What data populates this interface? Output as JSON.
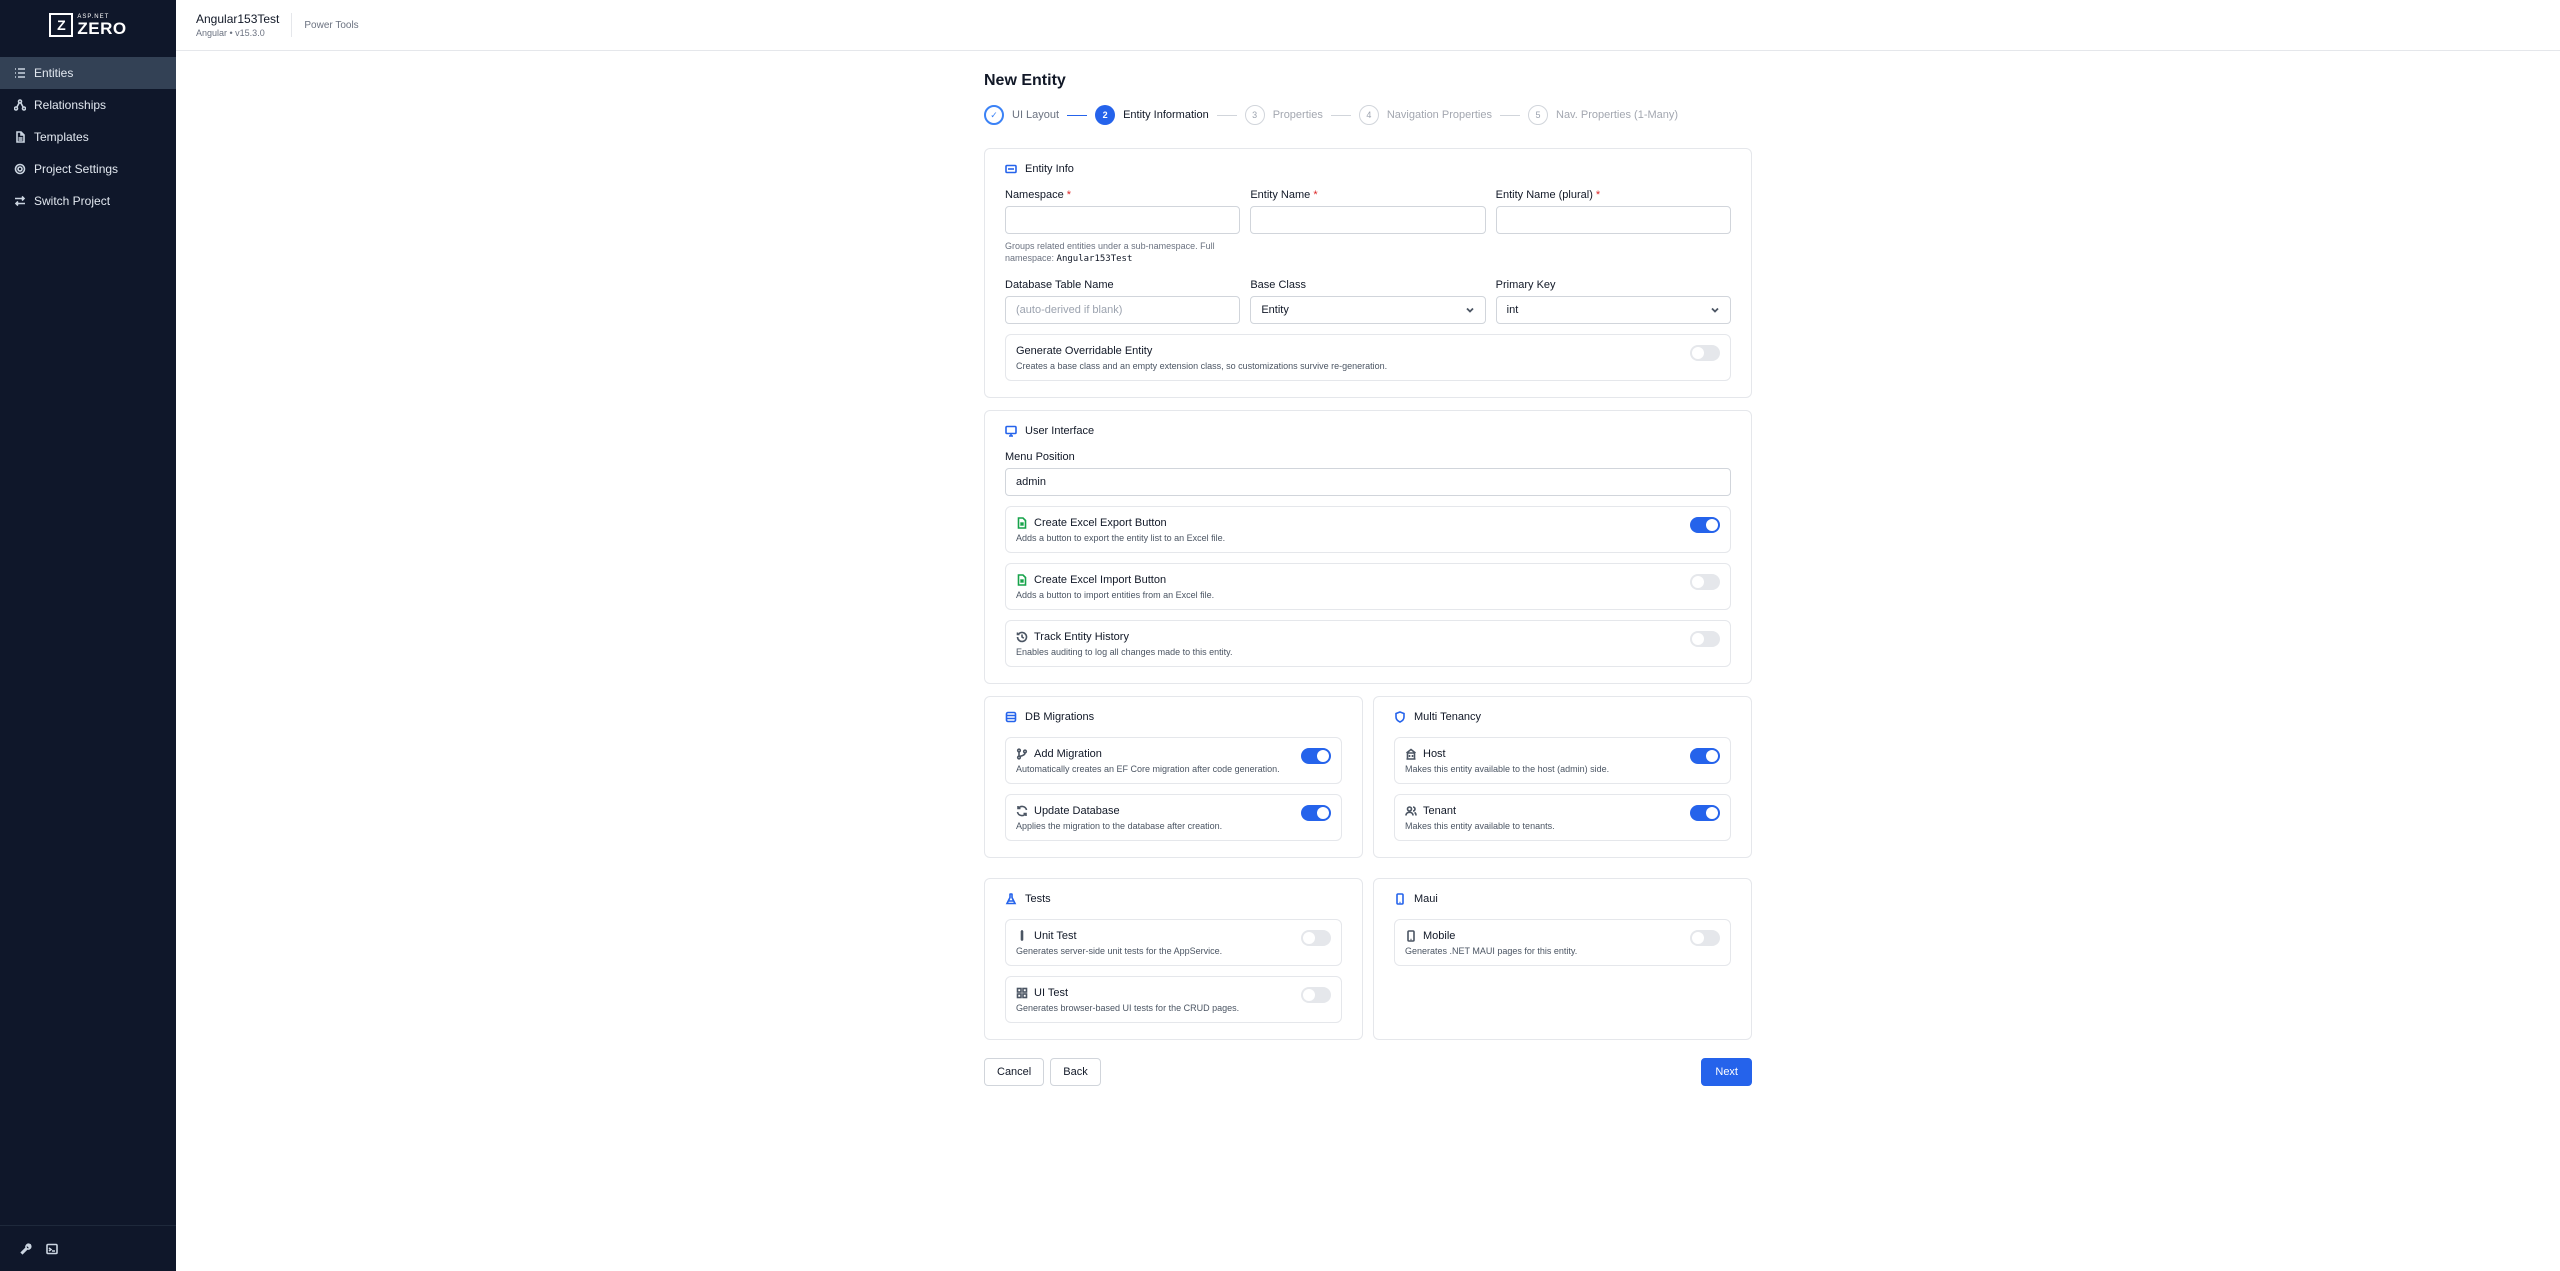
{
  "logo": {
    "mark": "Z",
    "small": "ASP.NET",
    "big": "ZERO"
  },
  "sidebar": {
    "items": [
      {
        "label": "Entities",
        "icon": "list-icon"
      },
      {
        "label": "Relationships",
        "icon": "relationship-icon"
      },
      {
        "label": "Templates",
        "icon": "file-icon"
      },
      {
        "label": "Project Settings",
        "icon": "gear-icon"
      },
      {
        "label": "Switch Project",
        "icon": "swap-icon"
      }
    ],
    "bottom_icons": [
      "wrench-icon",
      "terminal-icon"
    ]
  },
  "header": {
    "project_name": "Angular153Test",
    "project_version": "Angular • v15.3.0",
    "power_tools": "Power Tools"
  },
  "page": {
    "title": "New Entity"
  },
  "steps": [
    {
      "number": "✓",
      "label": "UI Layout",
      "state": "done"
    },
    {
      "number": "2",
      "label": "Entity Information",
      "state": "current"
    },
    {
      "number": "3",
      "label": "Properties",
      "state": "future"
    },
    {
      "number": "4",
      "label": "Navigation Properties",
      "state": "future"
    },
    {
      "number": "5",
      "label": "Nav. Properties (1-Many)",
      "state": "future"
    }
  ],
  "entity_info": {
    "title": "Entity Info",
    "namespace_label": "Namespace",
    "namespace_value": "",
    "namespace_hint": "Groups related entities under a sub-namespace. Full namespace: ",
    "namespace_hint_code": "Angular153Test",
    "entity_name_label": "Entity Name",
    "entity_name_value": "",
    "entity_plural_label": "Entity Name (plural)",
    "entity_plural_value": "",
    "required_mark": "*",
    "table_name_label": "Database Table Name",
    "table_name_placeholder": "(auto-derived if blank)",
    "base_class_label": "Base Class",
    "base_class_value": "Entity",
    "primary_key_label": "Primary Key",
    "primary_key_value": "int",
    "overridable_title": "Generate Overridable Entity",
    "overridable_desc": "Creates a base class and an empty extension class, so customizations survive re-generation.",
    "overridable_on": false
  },
  "user_interface": {
    "title": "User Interface",
    "menu_position_label": "Menu Position",
    "menu_position_value": "admin",
    "options": [
      {
        "title": "Create Excel Export Button",
        "desc": "Adds a button to export the entity list to an Excel file.",
        "on": true,
        "icon": "excel-file-icon"
      },
      {
        "title": "Create Excel Import Button",
        "desc": "Adds a button to import entities from an Excel file.",
        "on": false,
        "icon": "excel-file-icon"
      },
      {
        "title": "Track Entity History",
        "desc": "Enables auditing to log all changes made to this entity.",
        "on": false,
        "icon": "history-icon"
      }
    ]
  },
  "db_migrations": {
    "title": "DB Migrations",
    "options": [
      {
        "title": "Add Migration",
        "desc": "Automatically creates an EF Core migration after code generation.",
        "on": true,
        "icon": "git-branch-icon"
      },
      {
        "title": "Update Database",
        "desc": "Applies the migration to the database after creation.",
        "on": true,
        "icon": "refresh-icon"
      }
    ]
  },
  "multi_tenancy": {
    "title": "Multi Tenancy",
    "options": [
      {
        "title": "Host",
        "desc": "Makes this entity available to the host (admin) side.",
        "on": true,
        "icon": "building-icon"
      },
      {
        "title": "Tenant",
        "desc": "Makes this entity available to tenants.",
        "on": true,
        "icon": "users-icon"
      }
    ]
  },
  "tests": {
    "title": "Tests",
    "options": [
      {
        "title": "Unit Test",
        "desc": "Generates server-side unit tests for the AppService.",
        "on": false,
        "icon": "test-tube-icon"
      },
      {
        "title": "UI Test",
        "desc": "Generates browser-based UI tests for the CRUD pages.",
        "on": false,
        "icon": "grid-icon"
      }
    ]
  },
  "maui": {
    "title": "Maui",
    "options": [
      {
        "title": "Mobile",
        "desc": "Generates .NET MAUI pages for this entity.",
        "on": false,
        "icon": "mobile-icon"
      }
    ]
  },
  "footer": {
    "cancel": "Cancel",
    "back": "Back",
    "next": "Next"
  }
}
